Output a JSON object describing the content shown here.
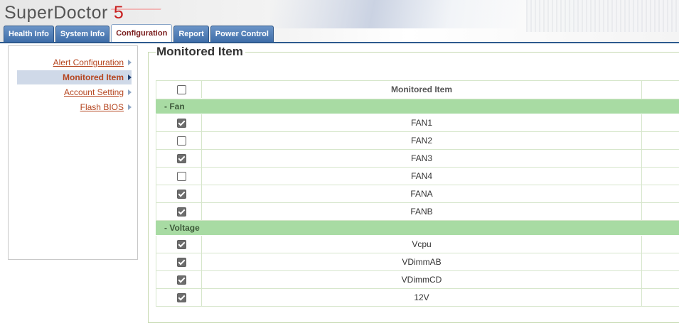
{
  "app": {
    "name": "SuperDoctor",
    "version": "5"
  },
  "tabs": [
    {
      "label": "Health Info",
      "active": false
    },
    {
      "label": "System Info",
      "active": false
    },
    {
      "label": "Configuration",
      "active": true
    },
    {
      "label": "Report",
      "active": false
    },
    {
      "label": "Power Control",
      "active": false
    }
  ],
  "sidebar": {
    "items": [
      {
        "label": "Alert Configuration",
        "selected": false
      },
      {
        "label": "Monitored Item",
        "selected": true
      },
      {
        "label": "Account Setting",
        "selected": false
      },
      {
        "label": "Flash BIOS",
        "selected": false
      }
    ]
  },
  "panel": {
    "title": "Monitored Item"
  },
  "table": {
    "header": {
      "checked": false,
      "column": "Monitored Item"
    },
    "groups": [
      {
        "name": "- Fan",
        "rows": [
          {
            "name": "FAN1",
            "checked": true
          },
          {
            "name": "FAN2",
            "checked": false
          },
          {
            "name": "FAN3",
            "checked": true
          },
          {
            "name": "FAN4",
            "checked": false
          },
          {
            "name": "FANA",
            "checked": true
          },
          {
            "name": "FANB",
            "checked": true
          }
        ]
      },
      {
        "name": "- Voltage",
        "rows": [
          {
            "name": "Vcpu",
            "checked": true
          },
          {
            "name": "VDimmAB",
            "checked": true
          },
          {
            "name": "VDimmCD",
            "checked": true
          },
          {
            "name": "12V",
            "checked": true
          }
        ]
      }
    ]
  },
  "colors": {
    "tab": "#4a78b0",
    "group_band": "#a8dba3",
    "link": "#b5451f",
    "version": "#c81e1e"
  }
}
